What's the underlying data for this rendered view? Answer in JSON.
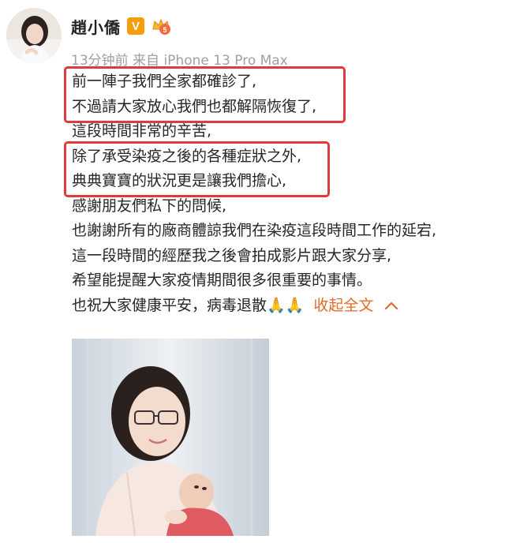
{
  "post": {
    "author": {
      "name": "趙小僑",
      "verified_badge": "V",
      "avatar_icon": "avatar-photo",
      "member_badge_icon": "crown-badge-icon"
    },
    "meta": "13分钟前 来自 iPhone 13 Pro Max",
    "lines": [
      "前一陣子我們全家都確診了,",
      "不過請大家放心我們也都解隔恢復了,",
      "這段時間非常的辛苦,",
      "除了承受染疫之後的各種症狀之外,",
      "典典寶寶的狀況更是讓我們擔心,",
      "感謝朋友們私下的問候,",
      "也謝謝所有的廠商體諒我們在染疫這段時間工作的延宕,",
      "這一段時間的經歷我之後會拍成影片跟大家分享,",
      "希望能提醒大家疫情期間很多很重要的事情。",
      "也祝大家健康平安，病毒退散🙏🙏"
    ],
    "collapse_label": "收起全文",
    "collapse_icon": "chevron-up-icon",
    "image_icon": "post-photo"
  },
  "colors": {
    "highlight_border": "#e03a3a",
    "link": "#e46a2a",
    "meta_text": "#a0a0a0",
    "verify_badge": "#f59d0a"
  }
}
